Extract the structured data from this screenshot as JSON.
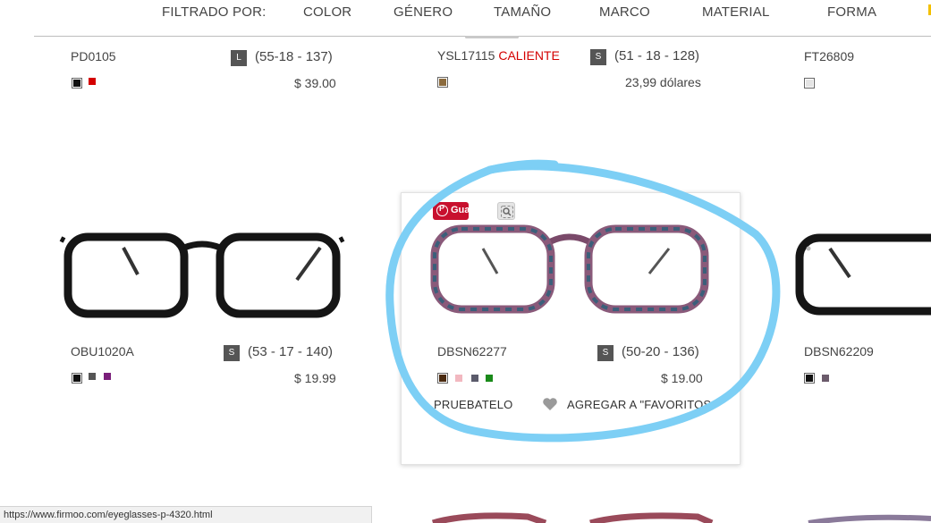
{
  "filters": {
    "label": "FILTRADO POR:",
    "items": [
      "COLOR",
      "GÉNERO",
      "TAMAÑO",
      "MARCO",
      "MATERIAL",
      "FORMA"
    ]
  },
  "products": [
    {
      "code": "PD0105",
      "badge": "",
      "size": "L",
      "dims": "(55-18 - 137)",
      "price": "$ 39.00",
      "swatches": [
        "#111111",
        "#d40000"
      ]
    },
    {
      "code": "YSL17115",
      "badge": "CALIENTE",
      "size": "S",
      "dims": "(51 - 18 - 128)",
      "price": "23,99 dólares",
      "swatches": [
        "#8b6b3d"
      ]
    },
    {
      "code": "FT26809",
      "badge": "",
      "size": "",
      "dims": "",
      "price": "",
      "swatches": [
        "#e4e4e4"
      ]
    },
    {
      "code": "OBU1020A",
      "badge": "",
      "size": "S",
      "dims": "(53 - 17 - 140)",
      "price": "$ 19.99",
      "swatches": [
        "#111111",
        "#555555",
        "#7a1f7a"
      ]
    },
    {
      "code": "DBSN62277",
      "badge": "",
      "size": "S",
      "dims": "(50-20 - 136)",
      "price": "$ 19.00",
      "swatches": [
        "#4a2a10",
        "#f2b8c0",
        "#5b5b6b",
        "#1a8a1a"
      ]
    },
    {
      "code": "DBSN62209",
      "badge": "",
      "size": "",
      "dims": "",
      "price": "",
      "swatches": [
        "#111111",
        "#6b5b6b"
      ]
    }
  ],
  "hover_card": {
    "pin_label": "Guardar",
    "try_on_label": "PRUEBATELO",
    "favorite_label": "AGREGAR A \"FAVORITOS"
  },
  "status_bar": {
    "url": "https://www.firmoo.com/eyeglasses-p-4320.html"
  },
  "colors": {
    "annotation_circle": "#7dcff5",
    "pin_red": "#c8102e",
    "hot_red": "#d40000",
    "size_box": "#555555"
  }
}
